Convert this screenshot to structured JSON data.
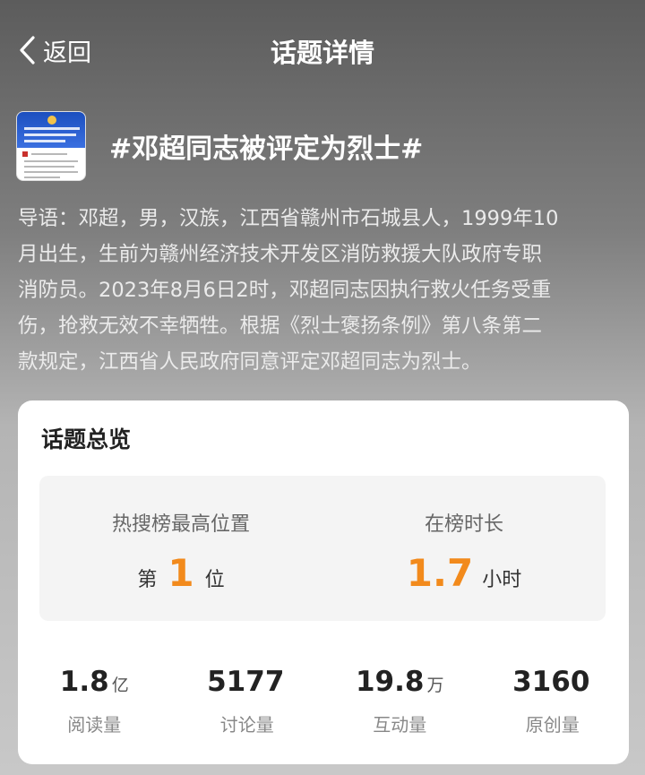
{
  "nav": {
    "back_label": "返回",
    "title": "话题详情"
  },
  "topic": {
    "title": "#邓超同志被评定为烈士#",
    "thumbnail_icon": "news-document-thumbnail",
    "intro_lines": [
      "导语：邓超，男，汉族，江西省赣州市石城县人，1999年10",
      "月出生，生前为赣州经济技术开发区消防救援大队政府专职",
      "消防员。2023年8月6日2时，邓超同志因执行救火任务受重",
      "伤，抢救无效不幸牺牲。根据《烈士褒扬条例》第八条第二",
      "款规定，江西省人民政府同意评定邓超同志为烈士。"
    ]
  },
  "overview": {
    "title": "话题总览",
    "rank": {
      "label": "热搜榜最高位置",
      "prefix": "第",
      "value": "1",
      "suffix": "位"
    },
    "duration": {
      "label": "在榜时长",
      "value": "1.7",
      "unit": "小时"
    },
    "stats": [
      {
        "value": "1.8",
        "unit": "亿",
        "label": "阅读量"
      },
      {
        "value": "5177",
        "unit": "",
        "label": "讨论量"
      },
      {
        "value": "19.8",
        "unit": "万",
        "label": "互动量"
      },
      {
        "value": "3160",
        "unit": "",
        "label": "原创量"
      }
    ]
  },
  "colors": {
    "accent_orange": "#f28a1c",
    "card_bg": "#ffffff"
  }
}
